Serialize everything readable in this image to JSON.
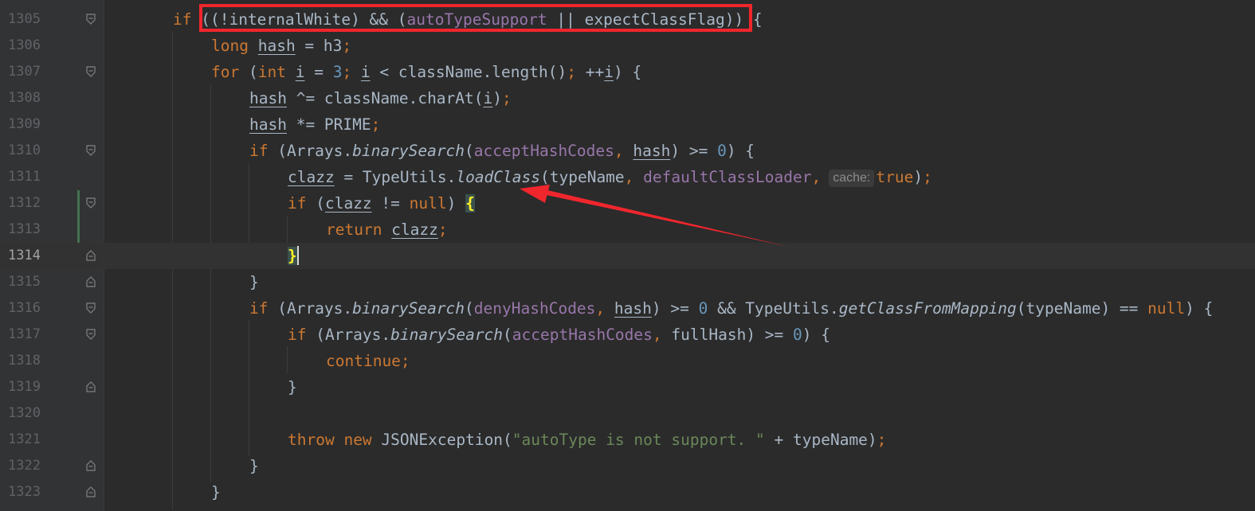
{
  "editor": {
    "current_line_number": "1314",
    "lines": [
      {
        "num": "1305",
        "fold": "open"
      },
      {
        "num": "1306",
        "fold": "none"
      },
      {
        "num": "1307",
        "fold": "open"
      },
      {
        "num": "1308",
        "fold": "none"
      },
      {
        "num": "1309",
        "fold": "none"
      },
      {
        "num": "1310",
        "fold": "open"
      },
      {
        "num": "1311",
        "fold": "none"
      },
      {
        "num": "1312",
        "fold": "open"
      },
      {
        "num": "1313",
        "fold": "none"
      },
      {
        "num": "1314",
        "fold": "close"
      },
      {
        "num": "1315",
        "fold": "close"
      },
      {
        "num": "1316",
        "fold": "open"
      },
      {
        "num": "1317",
        "fold": "open"
      },
      {
        "num": "1318",
        "fold": "none"
      },
      {
        "num": "1319",
        "fold": "close"
      },
      {
        "num": "1320",
        "fold": "none"
      },
      {
        "num": "1321",
        "fold": "none"
      },
      {
        "num": "1322",
        "fold": "close"
      },
      {
        "num": "1323",
        "fold": "close"
      }
    ]
  },
  "code": {
    "l1305": {
      "kw_if": "if",
      "paren_open": "((",
      "not_internal": "!internalWhite) && (",
      "auto_type_support": "autoTypeSupport",
      "or": " || expectClassFlag))",
      "brace": " {"
    },
    "l1306": {
      "kw_long": "long",
      "hash": "hash",
      "assign": " = h3",
      "semi": ";"
    },
    "l1307": {
      "kw_for": "for",
      "open": " (",
      "kw_int": "int",
      "i1": "i",
      "assign": " = ",
      "three": "3",
      "semi1": ";",
      "i2": "i",
      "cond": " < className.length()",
      "semi2": ";",
      "inc": " ++",
      "i3": "i",
      "close": ") {"
    },
    "l1308": {
      "hash": "hash",
      "op": " ^= className.charAt(",
      "i": "i",
      "close": ")",
      "semi": ";"
    },
    "l1309": {
      "hash": "hash",
      "op": " *= PRIME",
      "semi": ";"
    },
    "l1310": {
      "kw_if": "if",
      "arrays": " (Arrays.",
      "binary_search": "binarySearch",
      "open": "(",
      "accept_hash_codes": "acceptHashCodes",
      "comma": ",",
      "hash": "hash",
      "cmp": ") >= ",
      "zero": "0",
      "close": ") {"
    },
    "l1311": {
      "clazz": "clazz",
      "assign": " = TypeUtils.",
      "load_class": "loadClass",
      "args": "(typeName",
      "comma1": ", ",
      "default_class_loader": "defaultClassLoader",
      "comma2": ",",
      "hint_cache": "cache:",
      "kw_true": "true",
      "close": ")",
      "semi": ";"
    },
    "l1312": {
      "kw_if": "if",
      "open": " (",
      "clazz": "clazz",
      "neq": " != ",
      "kw_null": "null",
      "close": ") ",
      "brace": "{"
    },
    "l1313": {
      "kw_return": "return",
      "clazz": "clazz",
      "semi": ";"
    },
    "l1314": {
      "brace": "}"
    },
    "l1315": {
      "brace": "}"
    },
    "l1316": {
      "kw_if": "if",
      "arrays": " (Arrays.",
      "binary_search": "binarySearch",
      "open": "(",
      "deny_hash_codes": "denyHashCodes",
      "comma": ",",
      "hash": "hash",
      "cmp": ") >= ",
      "zero": "0",
      "and": " && TypeUtils.",
      "get_class_from_mapping": "getClassFromMapping",
      "args": "(typeName) == ",
      "kw_null": "null",
      "close": ") {"
    },
    "l1317": {
      "kw_if": "if",
      "arrays": " (Arrays.",
      "binary_search": "binarySearch",
      "open": "(",
      "accept_hash_codes": "acceptHashCodes",
      "comma": ",",
      "rest": " fullHash) >= ",
      "zero": "0",
      "close": ") {"
    },
    "l1318": {
      "kw_continue": "continue",
      "semi": ";"
    },
    "l1319": {
      "brace": "}"
    },
    "l1321": {
      "kw_throw": "throw",
      "kw_new": "new",
      "exc": " JSONException(",
      "message": "\"autoType is not support. \"",
      "plus": " + typeName)",
      "semi": ";"
    },
    "l1322": {
      "brace": "}"
    },
    "l1323": {
      "brace": "}"
    }
  },
  "annotations": {
    "highlight_color": "#f0262d",
    "arrow_color": "#f0262d"
  },
  "theme": {
    "background": "#2b2b2b",
    "gutter": "#313335",
    "keyword": "#cc7832",
    "number": "#6897bb",
    "field": "#9876aa",
    "string": "#6a8759",
    "text": "#a9b7c6"
  }
}
